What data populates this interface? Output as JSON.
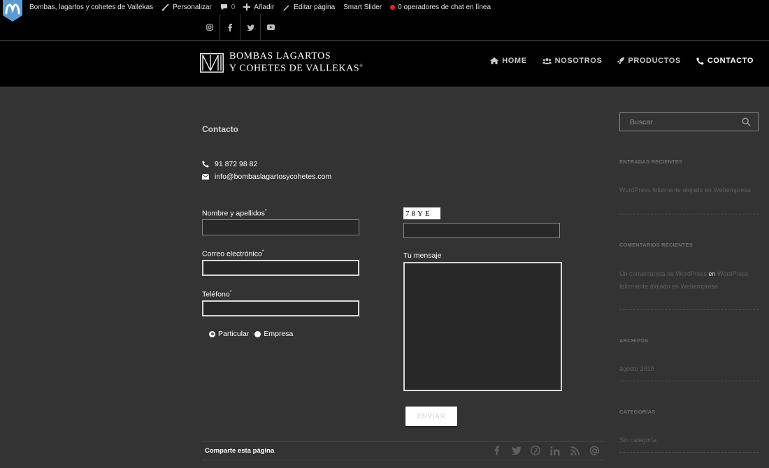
{
  "adminbar": {
    "site_name": "Bombas, lagartos y cohetes de Vallekas",
    "customize": "Personalizar",
    "comments_count": "0",
    "add": "Añadir",
    "edit_page": "Editar página",
    "smart_slider": "Smart Slider",
    "chat": "0 operadores de chat en línea"
  },
  "logo": {
    "line1": "BOMBAS LAGARTOS",
    "line2": "Y COHETES DE VALLEKAS",
    "reg": "®"
  },
  "nav": {
    "home": "HOME",
    "nosotros": "NOSOTROS",
    "productos": "PRODUCTOS",
    "contacto": "CONTACTO"
  },
  "page": {
    "title": "Contacto",
    "phone": "91 872 98 82",
    "email": "info@bombaslagartosycohetes.com"
  },
  "form": {
    "name_label": "Nombre y apellidos",
    "email_label": "Correo electrónico",
    "phone_label": "Teléfono",
    "required_mark": "*",
    "radio_particular": "Particular",
    "radio_empresa": "Empresa",
    "captcha_text": "78YE",
    "message_label": "Tu mensaje",
    "submit": "ENVIAR"
  },
  "share": {
    "label": "Comparte esta página"
  },
  "sidebar": {
    "search_placeholder": "Buscar",
    "recent_posts_title": "ENTRADAS RECIENTES",
    "recent_post": "WordPress felizmente alojado en Webempresa",
    "recent_comments_title": "COMENTARIOS RECIENTES",
    "comment_author": "Un comentarista de WordPress",
    "comment_on": "en",
    "comment_post": "WordPress felizmente alojado en Webempresa",
    "archives_title": "ARCHIVOS",
    "archive_item": "agosto 2019",
    "categories_title": "CATEGORÍAS",
    "category_item": "Sin categoría"
  },
  "colors": {
    "background": "#333333",
    "header": "#000000",
    "accent": "#ffffff",
    "chat_dot": "#e02424"
  }
}
